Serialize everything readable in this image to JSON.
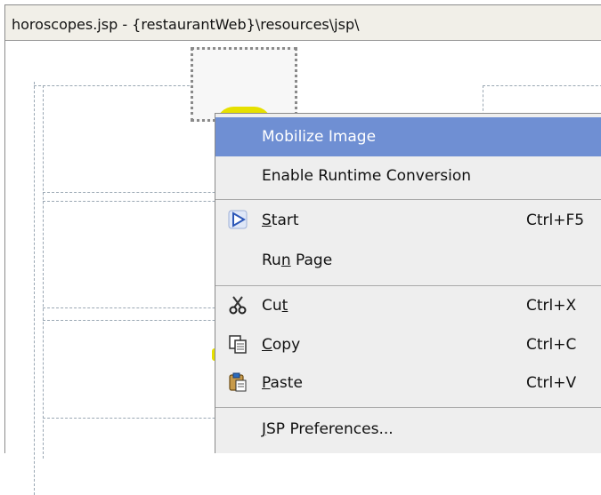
{
  "window": {
    "title": "horoscopes.jsp - {restaurantWeb}\\resources\\jsp\\"
  },
  "context_menu": {
    "mobilize_image": "Mobilize Image",
    "enable_runtime_conversion": "Enable Runtime Conversion",
    "start_prefix": "",
    "start_mnemonic": "S",
    "start_rest": "tart",
    "start_shortcut": "Ctrl+F5",
    "run_page_prefix": "Ru",
    "run_page_mnemonic": "n",
    "run_page_rest": " Page",
    "cut_prefix": "Cu",
    "cut_mnemonic": "t",
    "cut_rest": "",
    "cut_shortcut": "Ctrl+X",
    "copy_prefix": "",
    "copy_mnemonic": "C",
    "copy_rest": "opy",
    "copy_shortcut": "Ctrl+C",
    "paste_prefix": "",
    "paste_mnemonic": "P",
    "paste_rest": "aste",
    "paste_shortcut": "Ctrl+V",
    "jsp_prefs_prefix": "",
    "jsp_prefs_mnemonic": "J",
    "jsp_prefs_rest": "SP Preferences...",
    "highlight_color": "#6f8fd3"
  },
  "icons": {
    "start": "run-triangle-icon",
    "cut": "scissors-icon",
    "copy": "copy-icon",
    "paste": "clipboard-icon"
  }
}
